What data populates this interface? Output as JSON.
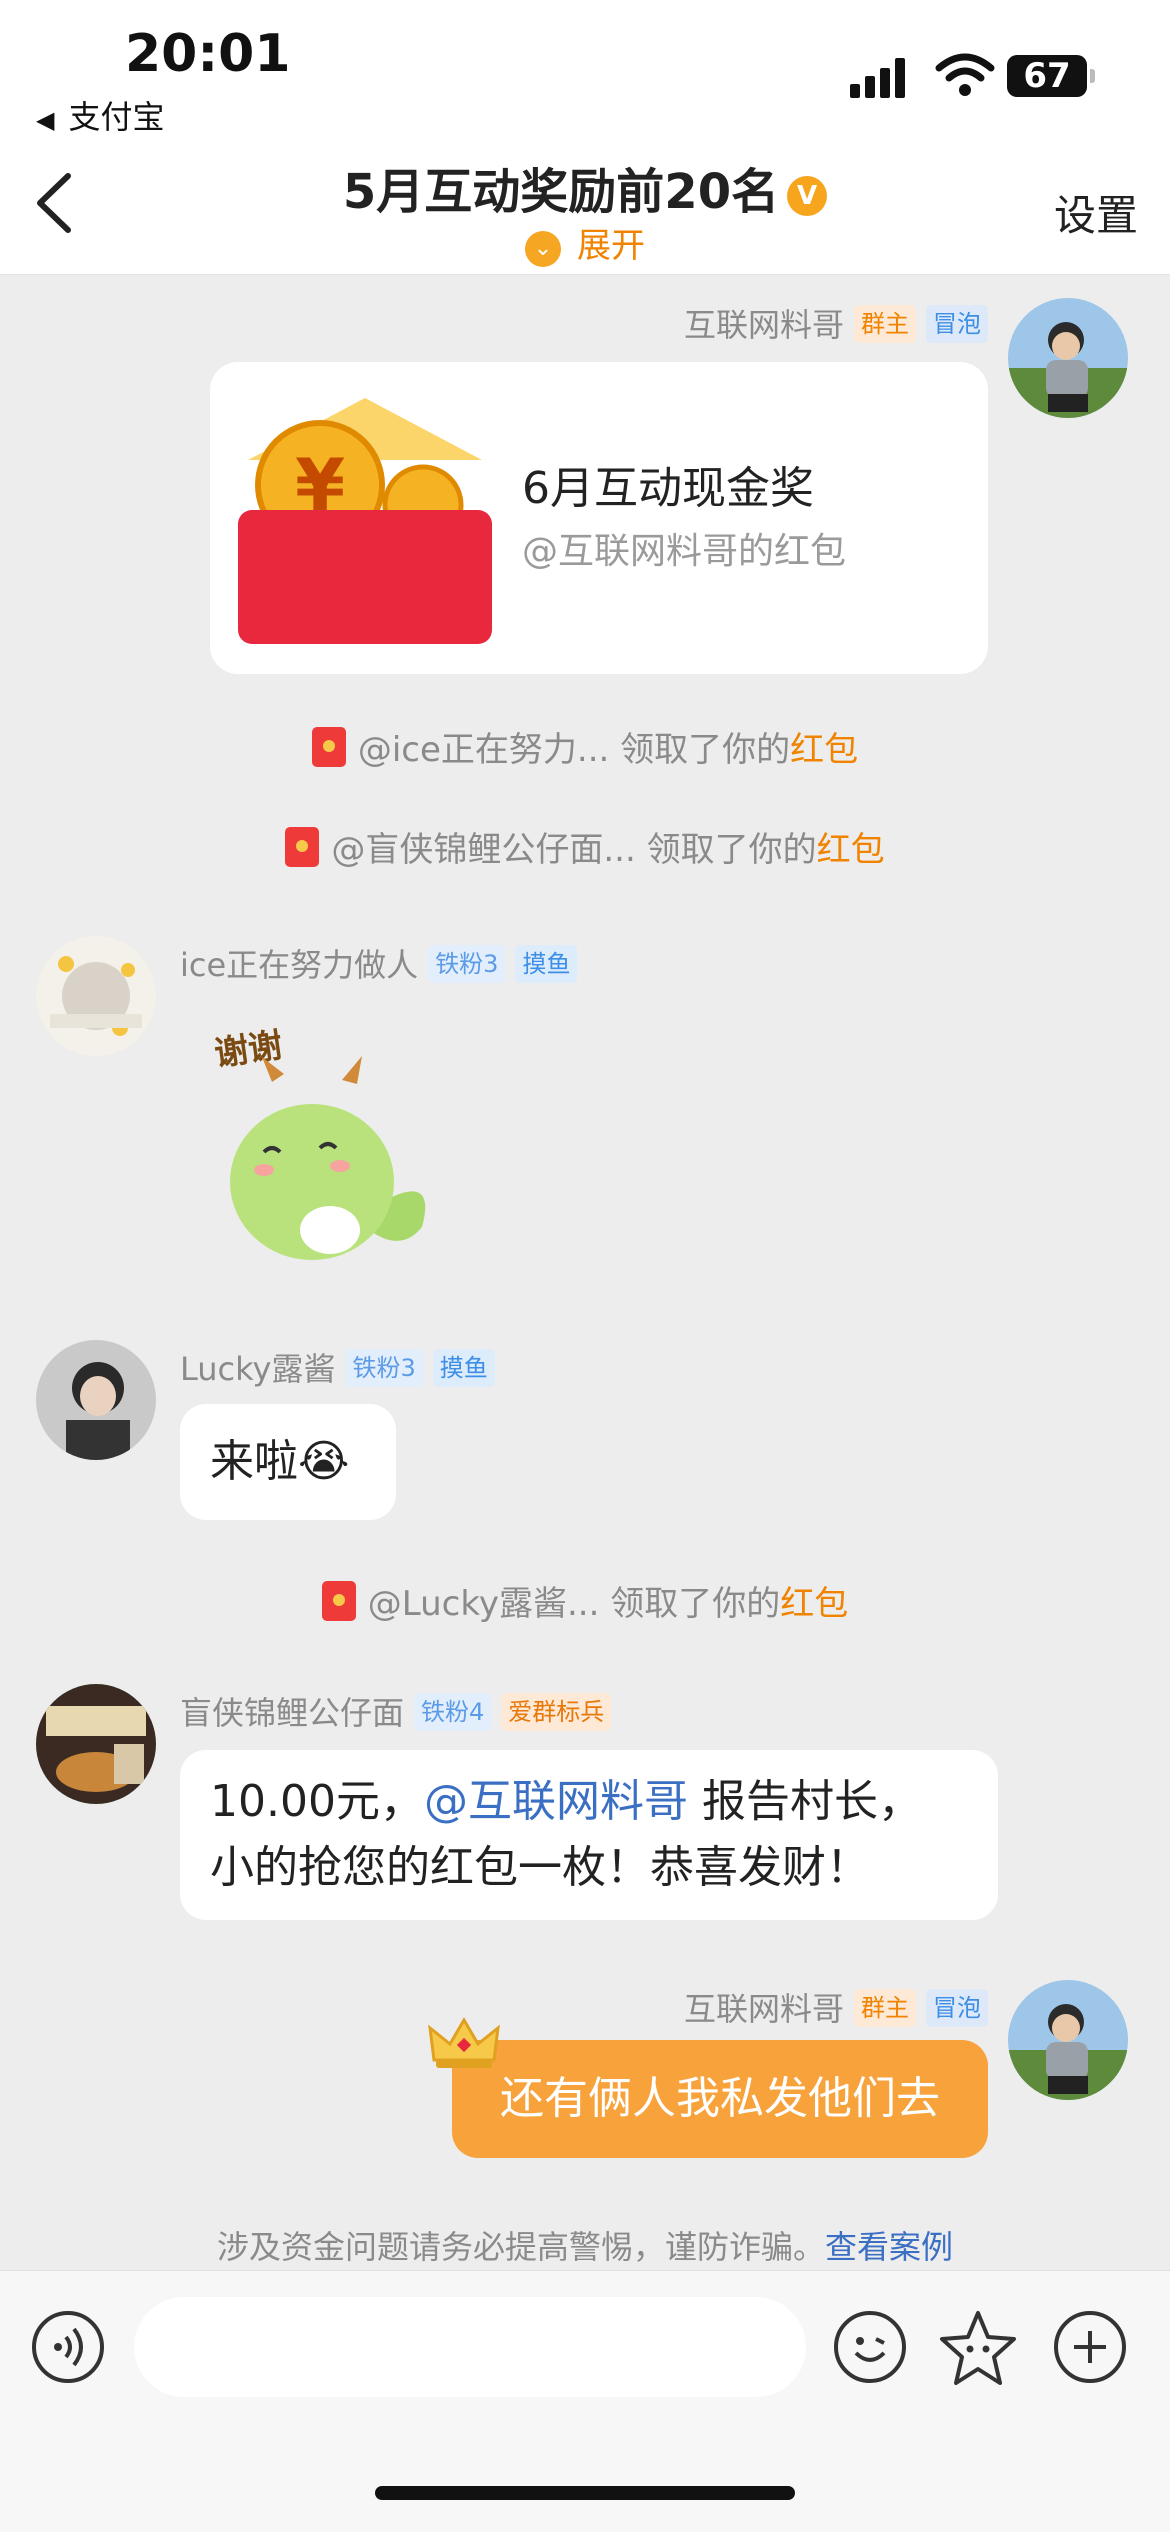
{
  "status_bar": {
    "time": "20:01",
    "back_app": "支付宝",
    "battery": "67"
  },
  "header": {
    "title": "5月互动奖励前20名",
    "badge": "V",
    "expand_label": "展开",
    "settings_label": "设置"
  },
  "messages": {
    "m1": {
      "sender": "互联网料哥",
      "tags": [
        "群主",
        "冒泡"
      ],
      "redpack_title": "6月互动现金奖",
      "redpack_sub": "@互联网料哥的红包"
    },
    "notice1": {
      "prefix": "@ice正在努力... 领取了你的",
      "link": "红包"
    },
    "notice2": {
      "prefix": "@盲侠锦鲤公仔面... 领取了你的",
      "link": "红包"
    },
    "m2": {
      "sender": "ice正在努力做人",
      "tags": [
        "铁粉3",
        "摸鱼"
      ],
      "sticker_text": "谢谢"
    },
    "m3": {
      "sender": "Lucky露酱",
      "tags": [
        "铁粉3",
        "摸鱼"
      ],
      "text": "来啦",
      "emoji": "😭"
    },
    "notice3": {
      "prefix": "@Lucky露酱... 领取了你的",
      "link": "红包"
    },
    "m4": {
      "sender": "盲侠锦鲤公仔面",
      "tags": [
        "铁粉4",
        "爱群标兵"
      ],
      "text_a": "10.00元，",
      "mention": "@互联网料哥",
      "text_b": " 报告村长，",
      "text_c": "小的抢您的红包一枚！恭喜发财！"
    },
    "m5": {
      "sender": "互联网料哥",
      "tags": [
        "群主",
        "冒泡"
      ],
      "text": "还有俩人我私发他们去"
    }
  },
  "warning": {
    "text": "涉及资金问题请务必提高警惕，谨防诈骗。",
    "link": "查看案例"
  },
  "colors": {
    "accent": "#f08300",
    "bubble_orange": "#f7a23a",
    "link_blue": "#3a6fc4"
  }
}
